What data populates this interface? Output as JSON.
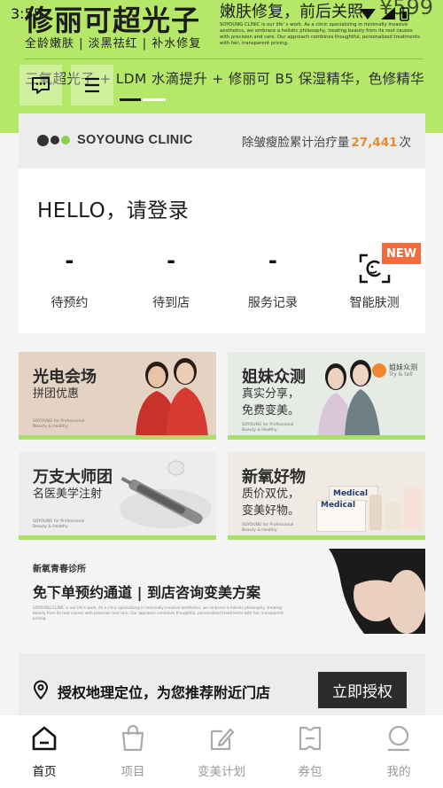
{
  "status_bar": {
    "time": "3:55"
  },
  "hero": {
    "title": "修丽可超光子",
    "subtitle": "全龄嫩肤 | 淡黑祛红 | 补水修复",
    "right_title": "嫩肤修复，前后关照",
    "price": "¥599",
    "description": "SOYOUNG CLINIC is our life' s work. As a clinic specializing in minimally invasive aesthetics, we embrace a holistic philosophy, treating beauty from its root causes with precision and care. Our approach combines thoughtful, personalized treatments with fair, transparent pricing.",
    "line2": "三氧超光子 + LDM 水滴提升 + 修丽可 B5 保湿精华，色修精华",
    "pager": {
      "total": 2,
      "current": 1
    }
  },
  "member_card": {
    "brand": "SOYOUNG CLINIC",
    "stat_prefix": "除皱瘦脸累计治疗量",
    "stat_value": "27,441",
    "stat_suffix": "次",
    "greeting": "HELLO，请登录",
    "quick_actions": [
      {
        "value": "-",
        "label": "待预约"
      },
      {
        "value": "-",
        "label": "待到店"
      },
      {
        "value": "-",
        "label": "服务记录"
      },
      {
        "icon": "face-scan-icon",
        "label": "智能肤测",
        "badge": "NEW"
      }
    ]
  },
  "tiles": [
    {
      "title": "光电会场",
      "subtitle": "拼团优惠",
      "tiny": "SOYOUNG for Professional Beauty & Healthy"
    },
    {
      "title": "姐妹众测",
      "subtitle": "真实分享，",
      "subtitle2": "免费变美。",
      "tiny": "SOYOUNG for Professional Beauty & Healthy",
      "logo_text": "姐妹众测",
      "logo_sub": "Try & tell"
    },
    {
      "title": "万支大师团",
      "subtitle": "名医美学注射",
      "tiny": "SOYOUNG for Professional Beauty & Healthy"
    },
    {
      "title": "新氧好物",
      "subtitle": "质价双优，",
      "subtitle2": "变美好物。",
      "tiny": "SOYOUNG for Professional Beauty & Healthy",
      "product_brand": "Medical"
    }
  ],
  "wide_banner": {
    "small": "新氧青春诊所",
    "big": "免下单预约通道 | 到店咨询变美方案",
    "desc": "SOYOUNG CLINIC is our life's work. As a clinic specializing in minimally invasive aesthetics, we embrace a holistic philosophy, treating beauty from its root causes with precision and care. Our approach combines thoughtful, personalized treatments with fair, transparent pricing."
  },
  "location": {
    "text": "授权地理定位，为您推荐附近门店",
    "button": "立即授权"
  },
  "nav": [
    {
      "label": "首页",
      "icon": "home-icon",
      "active": true
    },
    {
      "label": "项目",
      "icon": "bag-icon",
      "active": false
    },
    {
      "label": "变美计划",
      "icon": "pen-edit-icon",
      "active": false
    },
    {
      "label": "券包",
      "icon": "coupon-icon",
      "active": false
    },
    {
      "label": "我的",
      "icon": "profile-icon",
      "active": false
    }
  ],
  "colors": {
    "accent_green": "#b5e869",
    "stat_orange": "#e98b2a",
    "badge_orange": "#f26b3a",
    "dark": "#2b2b2b"
  }
}
